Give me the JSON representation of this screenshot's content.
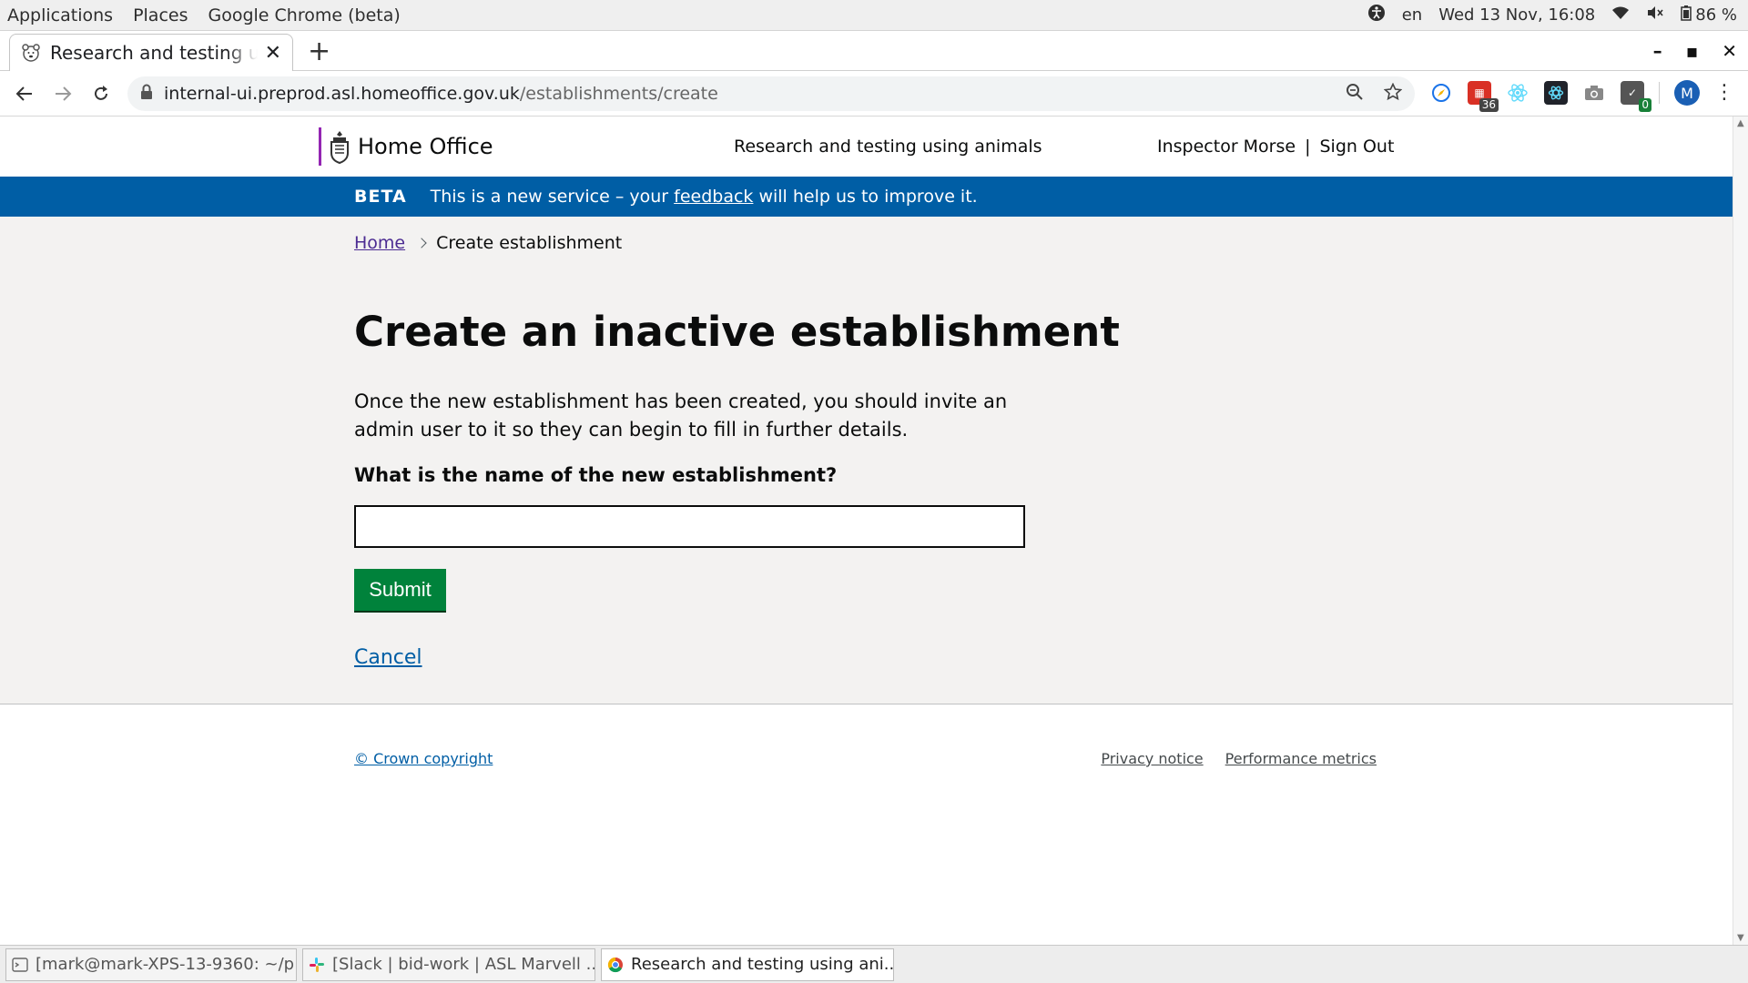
{
  "os_bar": {
    "menus": [
      "Applications",
      "Places",
      "Google Chrome (beta)"
    ],
    "lang": "en",
    "datetime": "Wed 13 Nov, 16:08",
    "battery": "86 %"
  },
  "browser": {
    "tab_title": "Research and testing u",
    "url_host": "internal-ui.preprod.asl.homeoffice.gov.uk",
    "url_path": "/establishments/create",
    "ext_badge_1": "36",
    "ext_badge_2": "0",
    "avatar_letter": "M"
  },
  "header": {
    "logo_text": "Home Office",
    "service_name": "Research and testing using animals",
    "user_name": "Inspector Morse",
    "separator": "|",
    "sign_out": "Sign Out"
  },
  "beta": {
    "tag": "BETA",
    "msg_before": "This is a new service – your ",
    "feedback_link": "feedback",
    "msg_after": " will help us to improve it."
  },
  "breadcrumb": {
    "home": "Home",
    "current": "Create establishment"
  },
  "main": {
    "heading": "Create an inactive establishment",
    "intro": "Once the new establishment has been created, you should invite an admin user to it so they can begin to fill in further details.",
    "question": "What is the name of the new establishment?",
    "input_value": "",
    "submit_label": "Submit",
    "cancel_label": "Cancel"
  },
  "footer": {
    "copyright": "© Crown copyright",
    "privacy": "Privacy notice",
    "metrics": "Performance metrics"
  },
  "taskbar": {
    "items": [
      "[mark@mark-XPS-13-9360: ~/p...",
      "[Slack | bid-work | ASL Marvell ...",
      "Research and testing using ani..."
    ]
  }
}
